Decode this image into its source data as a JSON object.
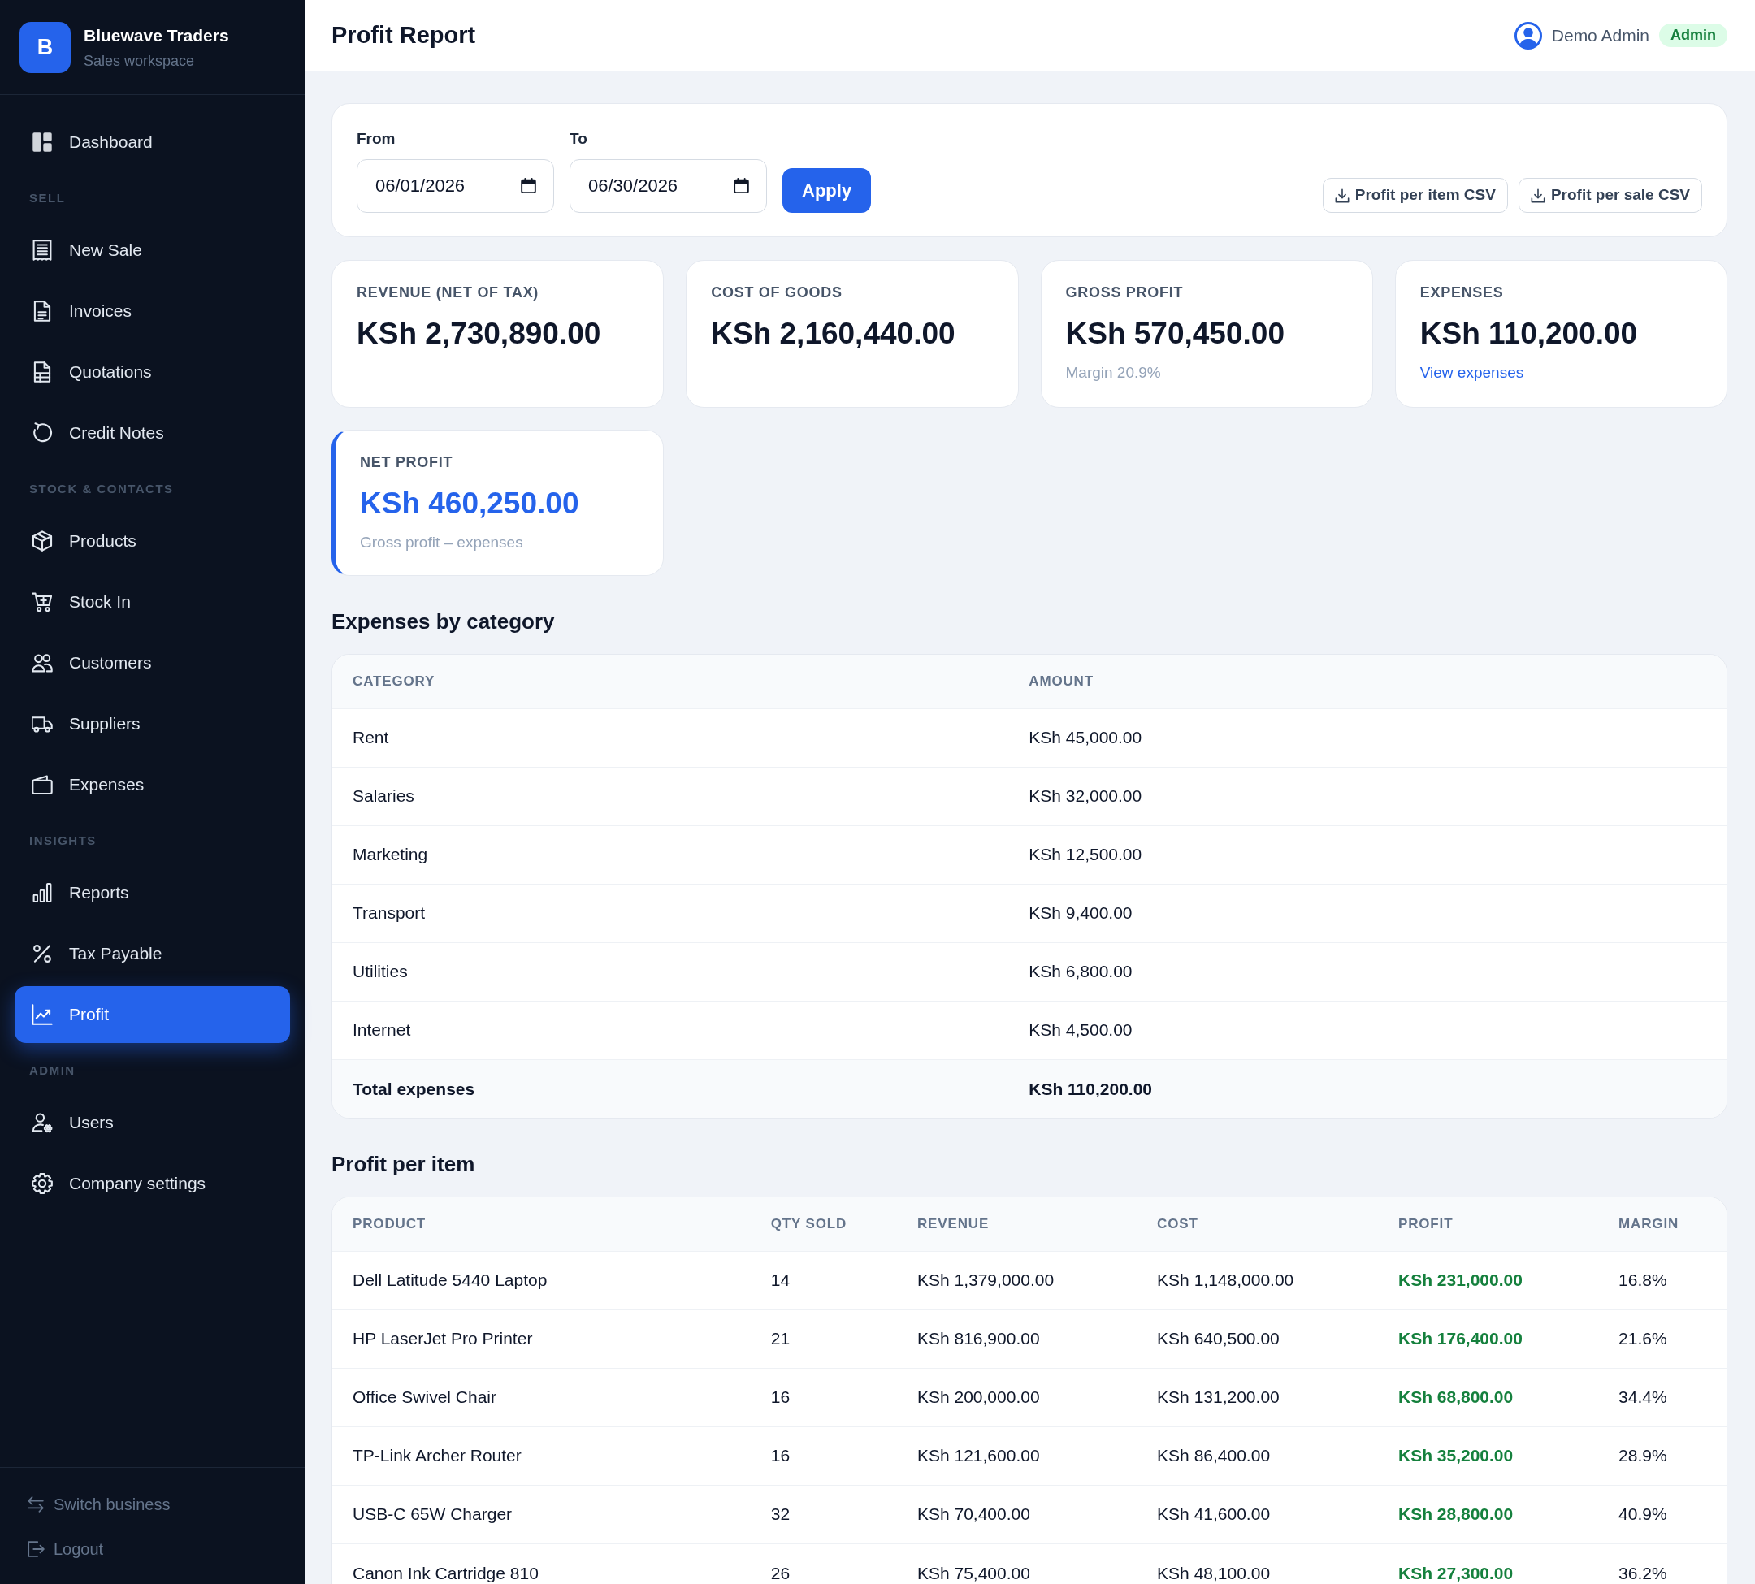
{
  "sidebar": {
    "brand": {
      "logo": "B",
      "name": "Bluewave Traders",
      "subtitle": "Sales workspace"
    },
    "nav": [
      {
        "items": [
          {
            "label": "Dashboard",
            "selected": false
          }
        ]
      },
      {
        "title": "SELL",
        "items": [
          {
            "label": "New Sale",
            "selected": false
          },
          {
            "label": "Invoices",
            "selected": false
          },
          {
            "label": "Quotations",
            "selected": false
          },
          {
            "label": "Credit Notes",
            "selected": false
          }
        ]
      },
      {
        "title": "STOCK & CONTACTS",
        "items": [
          {
            "label": "Products",
            "selected": false
          },
          {
            "label": "Stock In",
            "selected": false
          },
          {
            "label": "Customers",
            "selected": false
          },
          {
            "label": "Suppliers",
            "selected": false
          },
          {
            "label": "Expenses",
            "selected": false
          }
        ]
      },
      {
        "title": "INSIGHTS",
        "items": [
          {
            "label": "Reports",
            "selected": false
          },
          {
            "label": "Tax Payable",
            "selected": false
          },
          {
            "label": "Profit",
            "selected": true
          }
        ]
      },
      {
        "title": "ADMIN",
        "items": [
          {
            "label": "Users",
            "selected": false
          },
          {
            "label": "Company settings",
            "selected": false
          }
        ]
      }
    ],
    "footer": [
      "Switch business",
      "Logout"
    ]
  },
  "header": {
    "title": "Profit Report",
    "user": {
      "name": "Demo Admin",
      "role": "Admin"
    }
  },
  "filters": {
    "fields": [
      {
        "label": "From",
        "value": "06/01/2026"
      },
      {
        "label": "To",
        "value": "06/30/2026"
      }
    ],
    "apply": "Apply",
    "exports": [
      "Profit per item CSV",
      "Profit per sale CSV"
    ]
  },
  "kpis": [
    {
      "label": "REVENUE (NET OF TAX)",
      "value": "KSh 2,730,890.00",
      "highlight": false
    },
    {
      "label": "COST OF GOODS",
      "value": "KSh 2,160,440.00",
      "highlight": false
    },
    {
      "label": "GROSS PROFIT",
      "value": "KSh 570,450.00",
      "note": "Margin 20.9%",
      "highlight": false
    },
    {
      "label": "EXPENSES",
      "value": "KSh 110,200.00",
      "link": "View expenses",
      "highlight": false
    },
    {
      "label": "NET PROFIT",
      "value": "KSh 460,250.00",
      "note": "Gross profit – expenses",
      "highlight": true
    }
  ],
  "expenses_by_category": {
    "title": "Expenses by category",
    "columns": [
      "CATEGORY",
      "AMOUNT"
    ],
    "rows": [
      [
        "Rent",
        "KSh 45,000.00"
      ],
      [
        "Salaries",
        "KSh 32,000.00"
      ],
      [
        "Marketing",
        "KSh 12,500.00"
      ],
      [
        "Transport",
        "KSh 9,400.00"
      ],
      [
        "Utilities",
        "KSh 6,800.00"
      ],
      [
        "Internet",
        "KSh 4,500.00"
      ]
    ],
    "total": [
      "Total expenses",
      "KSh 110,200.00"
    ]
  },
  "profit_per_item": {
    "title": "Profit per item",
    "columns": [
      "PRODUCT",
      "QTY SOLD",
      "REVENUE",
      "COST",
      "PROFIT",
      "MARGIN"
    ],
    "rows": [
      [
        "Dell Latitude 5440 Laptop",
        "14",
        "KSh 1,379,000.00",
        "KSh 1,148,000.00",
        "KSh 231,000.00",
        "16.8%"
      ],
      [
        "HP LaserJet Pro Printer",
        "21",
        "KSh 816,900.00",
        "KSh 640,500.00",
        "KSh 176,400.00",
        "21.6%"
      ],
      [
        "Office Swivel Chair",
        "16",
        "KSh 200,000.00",
        "KSh 131,200.00",
        "KSh 68,800.00",
        "34.4%"
      ],
      [
        "TP-Link Archer Router",
        "16",
        "KSh 121,600.00",
        "KSh 86,400.00",
        "KSh 35,200.00",
        "28.9%"
      ],
      [
        "USB-C 65W Charger",
        "32",
        "KSh 70,400.00",
        "KSh 41,600.00",
        "KSh 28,800.00",
        "40.9%"
      ],
      [
        "Canon Ink Cartridge 810",
        "26",
        "KSh 75,400.00",
        "KSh 48,100.00",
        "KSh 27,300.00",
        "36.2%"
      ]
    ]
  }
}
